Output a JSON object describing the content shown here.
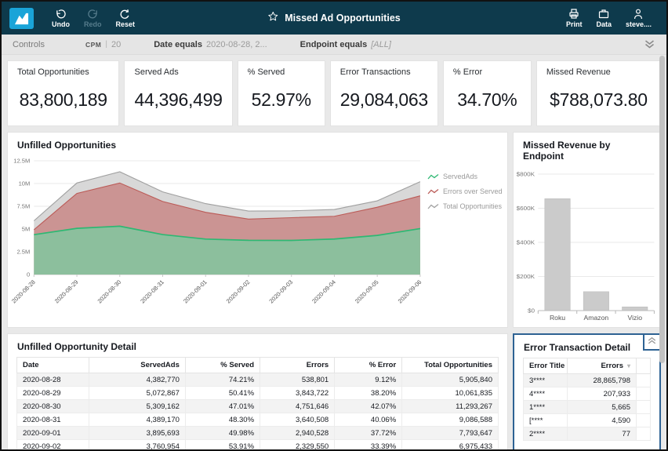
{
  "topbar": {
    "undo_label": "Undo",
    "redo_label": "Redo",
    "reset_label": "Reset",
    "title": "Missed Ad Opportunities",
    "print_label": "Print",
    "data_label": "Data",
    "user_label": "steve...."
  },
  "controls": {
    "title": "Controls",
    "cpm": {
      "label": "CPM",
      "value": "20"
    },
    "date": {
      "label": "Date equals",
      "value": "2020-08-28, 2..."
    },
    "endpoint": {
      "label": "Endpoint equals",
      "value": "[ALL]"
    }
  },
  "kpis": [
    {
      "label": "Total Opportunities",
      "value": "83,800,189"
    },
    {
      "label": "Served Ads",
      "value": "44,396,499"
    },
    {
      "label": "% Served",
      "value": "52.97%"
    },
    {
      "label": "Error Transactions",
      "value": "29,084,063"
    },
    {
      "label": "% Error",
      "value": "34.70%"
    },
    {
      "label": "Missed Revenue",
      "value": "$788,073.80"
    }
  ],
  "chart_data": [
    {
      "type": "area",
      "title": "Unfilled Opportunities",
      "x": [
        "2020-08-28",
        "2020-08-29",
        "2020-08-30",
        "2020-08-31",
        "2020-09-01",
        "2020-09-02",
        "2020-09-03",
        "2020-09-04",
        "2020-09-05",
        "2020-09-06"
      ],
      "series": [
        {
          "name": "ServedAds",
          "color": "#2eb873",
          "fill": "#8cbf9d",
          "values": [
            4382770,
            5072867,
            5309162,
            4389170,
            3895693,
            3760954,
            3750000,
            3900000,
            4300000,
            5050000
          ]
        },
        {
          "name": "Errors over Served",
          "color": "#bb5b57",
          "fill": "#cb9493",
          "stacked_on": "ServedAds",
          "values": [
            538801,
            3843722,
            4751646,
            3640508,
            2940528,
            2329550,
            2500000,
            2500000,
            3100000,
            3600000
          ]
        },
        {
          "name": "Total Opportunities",
          "color": "#a0a0a0",
          "fill": "#d8d8d8",
          "values": [
            5905840,
            10061835,
            11293267,
            9086588,
            7793647,
            6975433,
            7000000,
            7150000,
            8100000,
            10200000
          ]
        }
      ],
      "ylim": [
        0,
        12500000
      ],
      "yticks": [
        "0",
        "2.5M",
        "5M",
        "7.5M",
        "10M",
        "12.5M"
      ],
      "grid": true,
      "legend_position": "right"
    },
    {
      "type": "bar",
      "title": "Missed Revenue by Endpoint",
      "categories": [
        "Roku",
        "Amazon",
        "Vizio"
      ],
      "values": [
        656000,
        111000,
        22000
      ],
      "ylim": [
        0,
        800000
      ],
      "yticks": [
        "$0",
        "$200K",
        "$400K",
        "$600K",
        "$800K"
      ],
      "grid": true,
      "bar_color": "#cbcbcb"
    }
  ],
  "tables": {
    "unfilled": {
      "title": "Unfilled Opportunity Detail",
      "columns": [
        "Date",
        "ServedAds",
        "% Served",
        "Errors",
        "% Error",
        "Total Opportunities"
      ],
      "rows": [
        [
          "2020-08-28",
          "4,382,770",
          "74.21%",
          "538,801",
          "9.12%",
          "5,905,840"
        ],
        [
          "2020-08-29",
          "5,072,867",
          "50.41%",
          "3,843,722",
          "38.20%",
          "10,061,835"
        ],
        [
          "2020-08-30",
          "5,309,162",
          "47.01%",
          "4,751,646",
          "42.07%",
          "11,293,267"
        ],
        [
          "2020-08-31",
          "4,389,170",
          "48.30%",
          "3,640,508",
          "40.06%",
          "9,086,588"
        ],
        [
          "2020-09-01",
          "3,895,693",
          "49.98%",
          "2,940,528",
          "37.72%",
          "7,793,647"
        ],
        [
          "2020-09-02",
          "3,760,954",
          "53.91%",
          "2,329,550",
          "33.39%",
          "6,975,433"
        ]
      ]
    },
    "errors": {
      "title": "Error Transaction Detail",
      "columns": [
        "Error Title",
        "Errors"
      ],
      "rows": [
        [
          "3****",
          "28,865,798"
        ],
        [
          "4****",
          "207,933"
        ],
        [
          "1****",
          "5,665"
        ],
        [
          "[****",
          "4,590"
        ],
        [
          "2****",
          "77"
        ]
      ]
    }
  },
  "colors": {
    "topbar_bg": "#0e3a4c",
    "logo_blue": "#1aa4d8",
    "selection_blue": "#2e6293",
    "served_green": "#2eb873",
    "errors_red": "#bb5b57",
    "total_gray": "#a0a0a0",
    "bar_gray": "#cbcbcb"
  }
}
